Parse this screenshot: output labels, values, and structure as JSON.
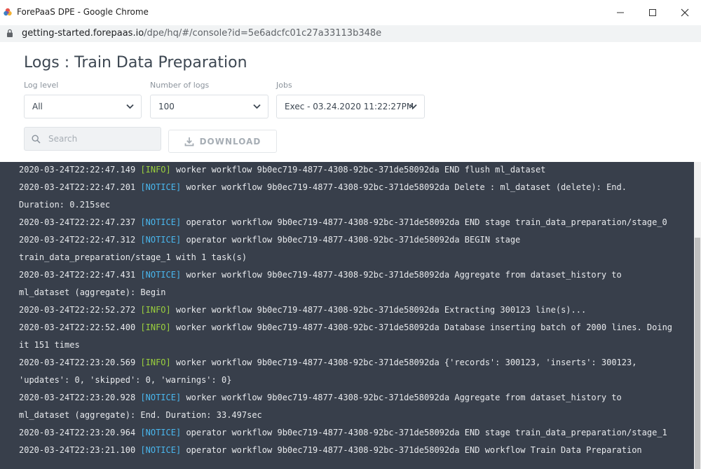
{
  "window": {
    "title": "ForePaaS DPE - Google Chrome",
    "url_host": "getting-started.forepaas.io",
    "url_rest": "/dpe/hq/#/console?id=5e6adcfc01c27a33113b348e"
  },
  "page": {
    "title": "Logs : Train Data Preparation"
  },
  "filters": {
    "log_level_label": "Log level",
    "log_level_value": "All",
    "number_label": "Number of logs",
    "number_value": "100",
    "jobs_label": "Jobs",
    "jobs_value": "Exec - 03.24.2020 11:22:27PM"
  },
  "search": {
    "placeholder": "Search"
  },
  "download": {
    "label": "DOWNLOAD"
  },
  "colors": {
    "console_bg": "#383f4b",
    "info": "#9bd13d",
    "notice": "#49b7ef"
  },
  "logs": [
    {
      "ts": "2020-03-24T22:22:47.149",
      "level": "[INFO]",
      "kind": "info",
      "text": "worker workflow 9b0ec719-4877-4308-92bc-371de58092da END flush ml_dataset",
      "cont": ""
    },
    {
      "ts": "2020-03-24T22:22:47.201",
      "level": "[NOTICE]",
      "kind": "notice",
      "text": "worker workflow 9b0ec719-4877-4308-92bc-371de58092da Delete : ml_dataset (delete): End.",
      "cont": "Duration: 0.215sec"
    },
    {
      "ts": "2020-03-24T22:22:47.237",
      "level": "[NOTICE]",
      "kind": "notice",
      "text": "operator workflow 9b0ec719-4877-4308-92bc-371de58092da END stage train_data_preparation/stage_0",
      "cont": ""
    },
    {
      "ts": "2020-03-24T22:22:47.312",
      "level": "[NOTICE]",
      "kind": "notice",
      "text": "operator workflow 9b0ec719-4877-4308-92bc-371de58092da BEGIN stage",
      "cont": "train_data_preparation/stage_1 with 1 task(s)"
    },
    {
      "ts": "2020-03-24T22:22:47.431",
      "level": "[NOTICE]",
      "kind": "notice",
      "text": "worker workflow 9b0ec719-4877-4308-92bc-371de58092da Aggregate from dataset_history to",
      "cont": "ml_dataset (aggregate): Begin"
    },
    {
      "ts": "2020-03-24T22:22:52.272",
      "level": "[INFO]",
      "kind": "info",
      "text": "worker workflow 9b0ec719-4877-4308-92bc-371de58092da Extracting 300123 line(s)...",
      "cont": ""
    },
    {
      "ts": "2020-03-24T22:22:52.400",
      "level": "[INFO]",
      "kind": "info",
      "text": "worker workflow 9b0ec719-4877-4308-92bc-371de58092da Database inserting batch of 2000 lines. Doing",
      "cont": "it 151 times"
    },
    {
      "ts": "2020-03-24T22:23:20.569",
      "level": "[INFO]",
      "kind": "info",
      "text": "worker workflow 9b0ec719-4877-4308-92bc-371de58092da {'records': 300123, 'inserts': 300123,",
      "cont": "'updates': 0, 'skipped': 0, 'warnings': 0}"
    },
    {
      "ts": "2020-03-24T22:23:20.928",
      "level": "[NOTICE]",
      "kind": "notice",
      "text": "worker workflow 9b0ec719-4877-4308-92bc-371de58092da Aggregate from dataset_history to",
      "cont": "ml_dataset (aggregate): End. Duration: 33.497sec"
    },
    {
      "ts": "2020-03-24T22:23:20.964",
      "level": "[NOTICE]",
      "kind": "notice",
      "text": "operator workflow 9b0ec719-4877-4308-92bc-371de58092da END stage train_data_preparation/stage_1",
      "cont": ""
    },
    {
      "ts": "2020-03-24T22:23:21.100",
      "level": "[NOTICE]",
      "kind": "notice",
      "text": "operator workflow 9b0ec719-4877-4308-92bc-371de58092da END workflow Train Data Preparation",
      "cont": ""
    }
  ]
}
